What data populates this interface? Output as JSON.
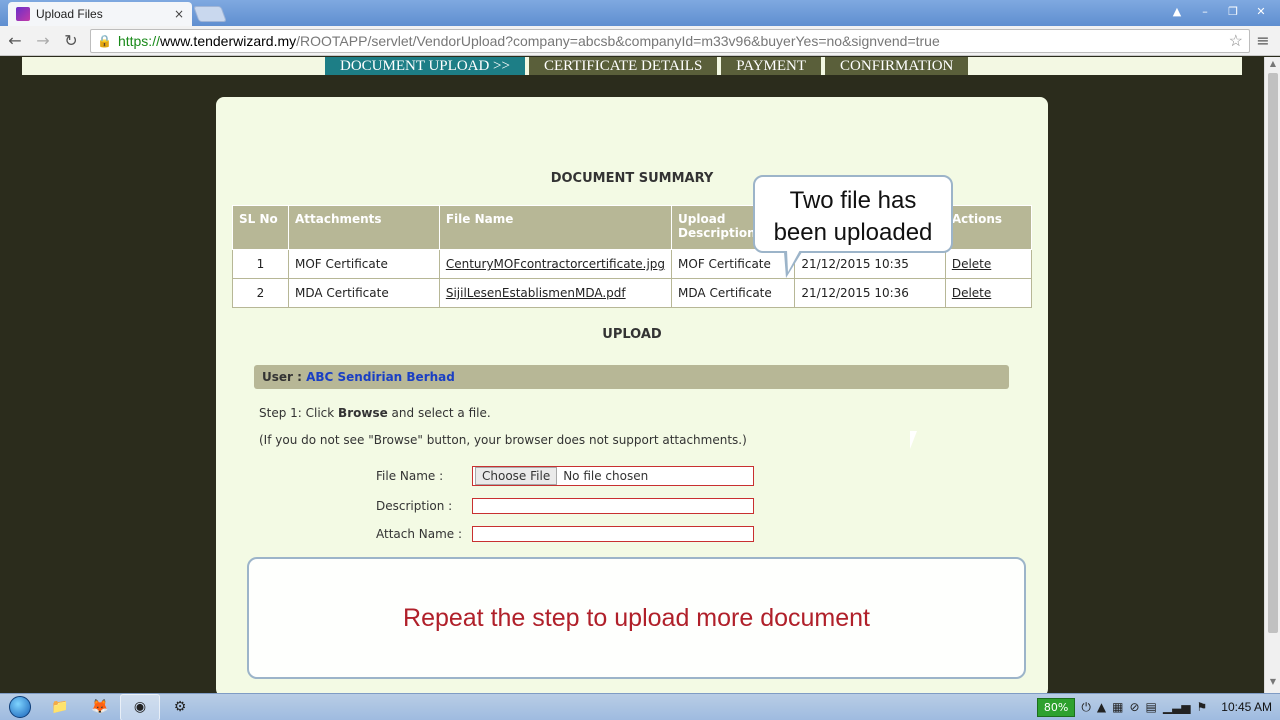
{
  "browser": {
    "tab_title": "Upload Files",
    "tab_close": "×",
    "url_scheme": "https://",
    "url_host": "www.tenderwizard.my",
    "url_path": "/ROOTAPP/servlet/VendorUpload?company=abcsb&companyId=m33v96&buyerYes=no&signvend=true"
  },
  "steps": [
    {
      "label": "DOCUMENT UPLOAD >>",
      "active": true
    },
    {
      "label": "CERTIFICATE DETAILS",
      "active": false
    },
    {
      "label": "PAYMENT",
      "active": false
    },
    {
      "label": "CONFIRMATION",
      "active": false
    }
  ],
  "summary": {
    "title": "DOCUMENT SUMMARY",
    "headers": {
      "sl": "SL No",
      "attachments": "Attachments",
      "file_name": "File Name",
      "upload_description": "Upload Description",
      "date": "",
      "actions": "Actions"
    },
    "rows": [
      {
        "sl": "1",
        "attachment": "MOF Certificate",
        "file": "CenturyMOFcontractorcertificate.jpg",
        "description": "MOF Certificate",
        "date": "21/12/2015 10:35",
        "action": "Delete"
      },
      {
        "sl": "2",
        "attachment": "MDA Certificate",
        "file": "SijilLesenEstablismenMDA.pdf",
        "description": "MDA Certificate",
        "date": "21/12/2015 10:36",
        "action": "Delete"
      }
    ]
  },
  "upload": {
    "title": "UPLOAD",
    "user_label": "User :",
    "user_value": "ABC Sendirian Berhad",
    "step1_prefix": "Step 1: Click ",
    "step1_bold": "Browse",
    "step1_suffix": " and select a file.",
    "note": "(If you do not see \"Browse\" button, your browser does not support attachments.)",
    "file_name_label": "File Name :",
    "choose_file": "Choose File",
    "no_file": "No file chosen",
    "description_label": "Description :",
    "attach_name_label": "Attach Name :"
  },
  "callouts": {
    "bubble_line1": "Two file has",
    "bubble_line2": "been uploaded",
    "notice": "Repeat the step to upload more document"
  },
  "taskbar": {
    "battery": "80%",
    "clock": "10:45 AM"
  },
  "colors": {
    "active_step": "#1d7e86",
    "inactive_step": "#5a5f3a",
    "page_bg": "#2b2c1c",
    "panel_bg": "#f3fae4",
    "table_header": "#b7b796",
    "notice_text": "#b0202a"
  }
}
